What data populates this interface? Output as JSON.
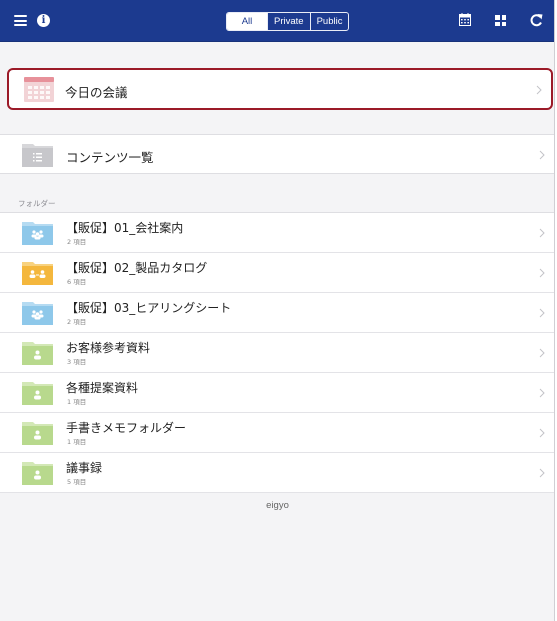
{
  "header": {
    "segments": [
      "All",
      "Private",
      "Public"
    ],
    "active_segment": "All",
    "icons": [
      "menu-icon",
      "info-icon",
      "calendar-icon",
      "grid-icon",
      "refresh-icon"
    ]
  },
  "today_meeting": {
    "label": "今日の会議",
    "icon": "calendar-icon",
    "accent_color": "#9b1a28"
  },
  "content_list": {
    "label": "コンテンツ一覧",
    "icon": "list-folder-icon"
  },
  "folders_section": {
    "header": "フォルダー",
    "items": [
      {
        "title": "【販促】01_会社案内",
        "count": "2 項目",
        "color": "blue"
      },
      {
        "title": "【販促】02_製品カタログ",
        "count": "6 項目",
        "color": "orange"
      },
      {
        "title": "【販促】03_ヒアリングシート",
        "count": "2 項目",
        "color": "blue"
      },
      {
        "title": "お客様参考資料",
        "count": "3 項目",
        "color": "green"
      },
      {
        "title": "各種提案資料",
        "count": "1 項目",
        "color": "green"
      },
      {
        "title": "手書きメモフォルダー",
        "count": "1 項目",
        "color": "green"
      },
      {
        "title": "議事録",
        "count": "5 項目",
        "color": "green"
      }
    ]
  },
  "footer": {
    "user": "eigyo"
  },
  "colors": {
    "header_bg": "#1c3a8f",
    "folder_blue": "#8ec8ea",
    "folder_orange": "#f4b73d",
    "folder_green": "#b8d98d"
  }
}
